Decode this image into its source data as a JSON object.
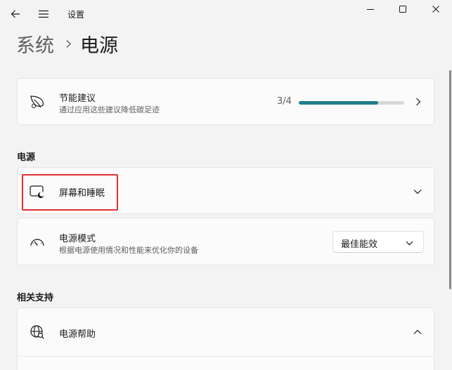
{
  "app": {
    "title": "设置"
  },
  "breadcrumb": {
    "parent": "系统",
    "current": "电源"
  },
  "energy": {
    "title": "节能建议",
    "subtitle": "通过应用这些建议降低碳足迹",
    "progress_text": "3/4",
    "progress_fraction": 0.75,
    "accent": "#1f7e87"
  },
  "power_section": {
    "label": "电源",
    "screen_sleep": {
      "title": "屏幕和睡眠"
    },
    "power_mode": {
      "title": "电源模式",
      "subtitle": "根据电源使用情况和性能来优化你的设备",
      "selected": "最佳能效"
    }
  },
  "related": {
    "label": "相关支持",
    "power_help": {
      "title": "电源帮助"
    }
  },
  "highlight_color": "#e0312f"
}
